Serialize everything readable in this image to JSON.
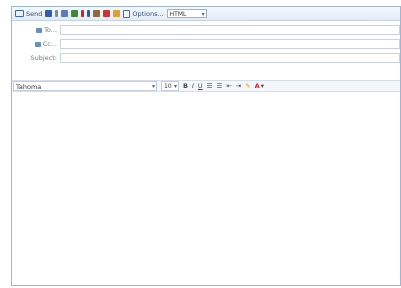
{
  "toolbar": {
    "send_label": "Send",
    "options_label": "Options...",
    "format_value": "HTML",
    "colors": {
      "save": "#2f5fa8",
      "flag": "#cc2222",
      "check": "#3a8a3a",
      "importance": "#d4a017"
    }
  },
  "header": {
    "to_label": "To...",
    "cc_label": "Cc...",
    "subject_label": "Subject:",
    "to_value": "",
    "cc_value": "",
    "subject_value": ""
  },
  "format": {
    "font_value": "Tahoma",
    "size_value": "10",
    "bold_label": "B",
    "italic_label": "I",
    "underline_label": "U"
  },
  "body": {
    "text": ""
  }
}
